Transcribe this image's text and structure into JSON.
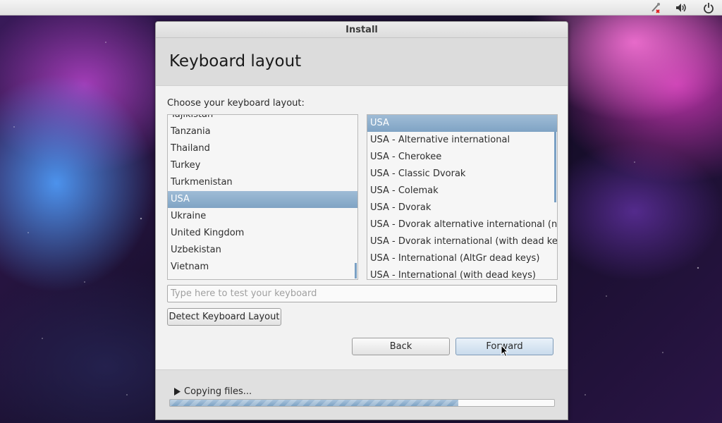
{
  "tray": {
    "icons": [
      "network-disconnected-icon",
      "volume-icon",
      "power-icon"
    ]
  },
  "window": {
    "title": "Install",
    "page_title": "Keyboard layout",
    "choose_label": "Choose your keyboard layout:"
  },
  "countries": {
    "items": [
      "Tajikistan",
      "Tanzania",
      "Thailand",
      "Turkey",
      "Turkmenistan",
      "USA",
      "Ukraine",
      "United Kingdom",
      "Uzbekistan",
      "Vietnam"
    ],
    "selected": "USA"
  },
  "variants": {
    "items": [
      "USA",
      "USA - Alternative international",
      "USA - Cherokee",
      "USA - Classic Dvorak",
      "USA - Colemak",
      "USA - Dvorak",
      "USA - Dvorak alternative international (no",
      "USA - Dvorak international (with dead key",
      "USA - International (AltGr dead keys)",
      "USA - International (with dead keys)"
    ],
    "selected": "USA"
  },
  "test_input": {
    "placeholder": "Type here to test your keyboard",
    "value": ""
  },
  "buttons": {
    "detect": "Detect Keyboard Layout",
    "back": "Back",
    "forward": "Forward"
  },
  "footer": {
    "status": "Copying files...",
    "progress": 0.75
  },
  "colors": {
    "selection": "#7fa3c4",
    "progress": "#7da2c4"
  }
}
